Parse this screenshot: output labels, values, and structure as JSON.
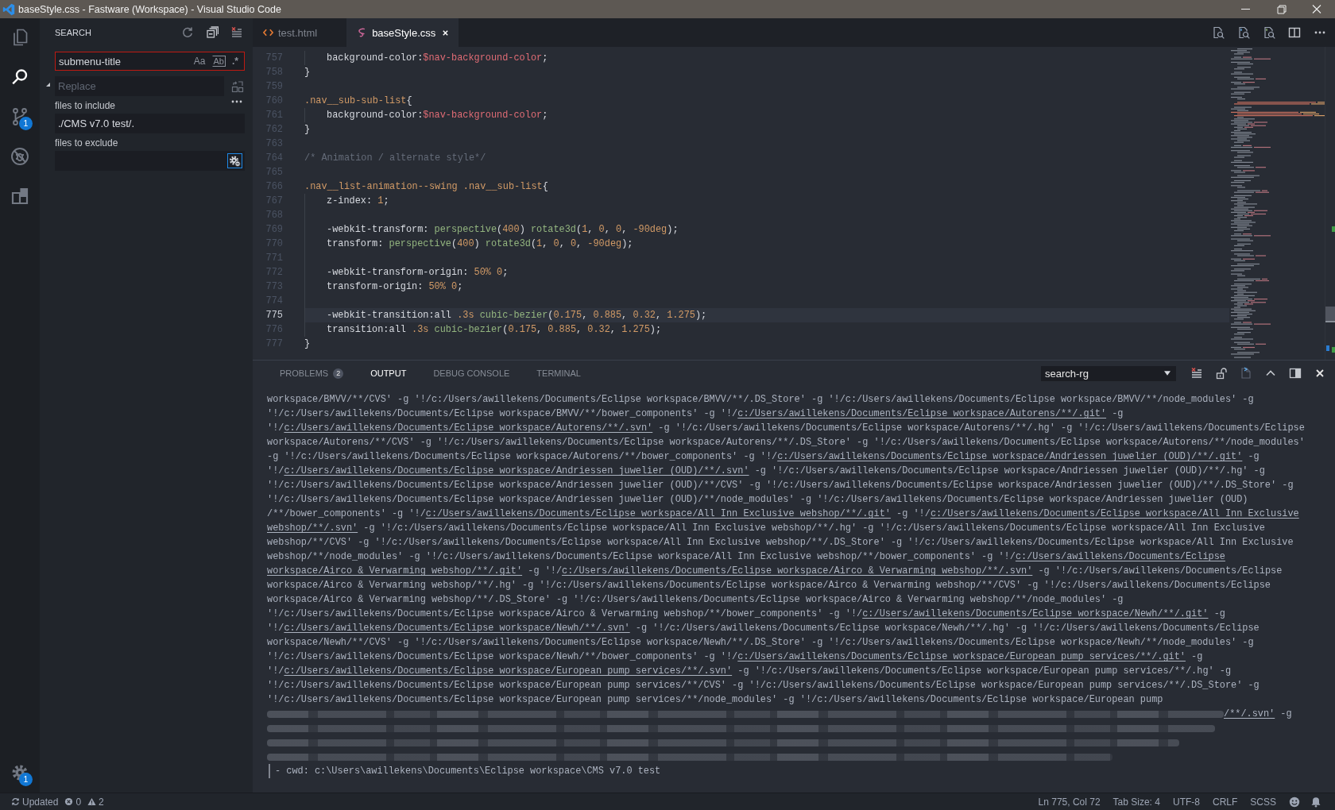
{
  "window": {
    "title": "baseStyle.css - Fastware (Workspace) - Visual Studio Code"
  },
  "activity_bar": {
    "items": [
      {
        "kind": "explorer",
        "selected": false
      },
      {
        "kind": "search",
        "selected": true
      },
      {
        "kind": "source_control",
        "selected": false,
        "badge": "1"
      },
      {
        "kind": "debug",
        "selected": false
      },
      {
        "kind": "extensions",
        "selected": false
      }
    ],
    "manage": {
      "badge": "1"
    }
  },
  "sidebar": {
    "title": "SEARCH",
    "search": {
      "value": "submenu-title",
      "toggles": [
        {
          "kind": "case",
          "label": "Aa",
          "on": false
        },
        {
          "kind": "word",
          "label": "Ab",
          "on": false
        },
        {
          "kind": "regex",
          "label": ".*",
          "on": false
        }
      ]
    },
    "replace": {
      "expanded": true,
      "placeholder": "Replace"
    },
    "include": {
      "label": "files to include",
      "value": "./CMS v7.0 test/."
    },
    "exclude": {
      "label": "files to exclude",
      "use_settings": true
    }
  },
  "editor": {
    "tabs": [
      {
        "kind": "html",
        "label": "test.html",
        "selected": false
      },
      {
        "kind": "sass",
        "label": "baseStyle.css",
        "selected": true
      }
    ],
    "lines": [
      {
        "number": "757",
        "indented": true,
        "current": false,
        "tokens": [
          {
            "kind": "property",
            "text": "background-color:"
          },
          {
            "kind": "variable",
            "text": "$nav-background-color"
          },
          {
            "kind": "punct",
            "text": ";"
          }
        ]
      },
      {
        "number": "758",
        "indented": false,
        "current": false,
        "tokens": [
          {
            "kind": "punct",
            "text": "}"
          }
        ]
      },
      {
        "number": "759",
        "indented": false,
        "current": false
      },
      {
        "number": "760",
        "indented": false,
        "current": false,
        "tokens": [
          {
            "kind": "selector",
            "text": ".nav__sub-sub-list"
          },
          {
            "kind": "punct",
            "text": "{"
          }
        ]
      },
      {
        "number": "761",
        "indented": true,
        "current": false,
        "tokens": [
          {
            "kind": "property",
            "text": "background-color:"
          },
          {
            "kind": "variable",
            "text": "$nav-background-color"
          },
          {
            "kind": "punct",
            "text": ";"
          }
        ]
      },
      {
        "number": "762",
        "indented": false,
        "current": false,
        "tokens": [
          {
            "kind": "punct",
            "text": "}"
          }
        ]
      },
      {
        "number": "763",
        "indented": false,
        "current": false
      },
      {
        "number": "764",
        "indented": false,
        "current": false,
        "tokens": [
          {
            "kind": "comment",
            "text": "/* Animation / alternate style*/"
          }
        ]
      },
      {
        "number": "765",
        "indented": false,
        "current": false
      },
      {
        "number": "766",
        "indented": false,
        "current": false,
        "tokens": [
          {
            "kind": "selector",
            "text": ".nav__list-animation--swing .nav__sub-list"
          },
          {
            "kind": "punct",
            "text": "{"
          }
        ]
      },
      {
        "number": "767",
        "indented": true,
        "current": false,
        "tokens": [
          {
            "kind": "property",
            "text": "z-index: "
          },
          {
            "kind": "number",
            "text": "1"
          },
          {
            "kind": "punct",
            "text": ";"
          }
        ]
      },
      {
        "number": "768",
        "indented": true,
        "current": false
      },
      {
        "number": "769",
        "indented": true,
        "current": false,
        "tokens": [
          {
            "kind": "property",
            "text": "-webkit-transform: "
          },
          {
            "kind": "function",
            "text": "perspective"
          },
          {
            "kind": "punct",
            "text": "("
          },
          {
            "kind": "number",
            "text": "400"
          },
          {
            "kind": "punct",
            "text": ") "
          },
          {
            "kind": "function",
            "text": "rotate3d"
          },
          {
            "kind": "punct",
            "text": "("
          },
          {
            "kind": "number",
            "text": "1"
          },
          {
            "kind": "punct",
            "text": ", "
          },
          {
            "kind": "number",
            "text": "0"
          },
          {
            "kind": "punct",
            "text": ", "
          },
          {
            "kind": "number",
            "text": "0"
          },
          {
            "kind": "punct",
            "text": ", "
          },
          {
            "kind": "number",
            "text": "-90deg"
          },
          {
            "kind": "punct",
            "text": ");"
          }
        ]
      },
      {
        "number": "770",
        "indented": true,
        "current": false,
        "tokens": [
          {
            "kind": "property",
            "text": "transform: "
          },
          {
            "kind": "function",
            "text": "perspective"
          },
          {
            "kind": "punct",
            "text": "("
          },
          {
            "kind": "number",
            "text": "400"
          },
          {
            "kind": "punct",
            "text": ") "
          },
          {
            "kind": "function",
            "text": "rotate3d"
          },
          {
            "kind": "punct",
            "text": "("
          },
          {
            "kind": "number",
            "text": "1"
          },
          {
            "kind": "punct",
            "text": ", "
          },
          {
            "kind": "number",
            "text": "0"
          },
          {
            "kind": "punct",
            "text": ", "
          },
          {
            "kind": "number",
            "text": "0"
          },
          {
            "kind": "punct",
            "text": ", "
          },
          {
            "kind": "number",
            "text": "-90deg"
          },
          {
            "kind": "punct",
            "text": ");"
          }
        ]
      },
      {
        "number": "771",
        "indented": true,
        "current": false
      },
      {
        "number": "772",
        "indented": true,
        "current": false,
        "tokens": [
          {
            "kind": "property",
            "text": "-webkit-transform-origin: "
          },
          {
            "kind": "number",
            "text": "50% 0"
          },
          {
            "kind": "punct",
            "text": ";"
          }
        ]
      },
      {
        "number": "773",
        "indented": true,
        "current": false,
        "tokens": [
          {
            "kind": "property",
            "text": "transform-origin: "
          },
          {
            "kind": "number",
            "text": "50% 0"
          },
          {
            "kind": "punct",
            "text": ";"
          }
        ]
      },
      {
        "number": "774",
        "indented": true,
        "current": false
      },
      {
        "number": "775",
        "indented": true,
        "current": true,
        "tokens": [
          {
            "kind": "property",
            "text": "-webkit-transition:all "
          },
          {
            "kind": "number",
            "text": ".3s "
          },
          {
            "kind": "function",
            "text": "cubic-bezier"
          },
          {
            "kind": "punct",
            "text": "("
          },
          {
            "kind": "number",
            "text": "0.175"
          },
          {
            "kind": "punct",
            "text": ", "
          },
          {
            "kind": "number",
            "text": "0.885"
          },
          {
            "kind": "punct",
            "text": ", "
          },
          {
            "kind": "number",
            "text": "0.32"
          },
          {
            "kind": "punct",
            "text": ", "
          },
          {
            "kind": "number",
            "text": "1.275"
          },
          {
            "kind": "punct",
            "text": ");"
          }
        ]
      },
      {
        "number": "776",
        "indented": true,
        "current": false,
        "tokens": [
          {
            "kind": "property",
            "text": "transition:all "
          },
          {
            "kind": "number",
            "text": ".3s "
          },
          {
            "kind": "function",
            "text": "cubic-bezier"
          },
          {
            "kind": "punct",
            "text": "("
          },
          {
            "kind": "number",
            "text": "0.175"
          },
          {
            "kind": "punct",
            "text": ", "
          },
          {
            "kind": "number",
            "text": "0.885"
          },
          {
            "kind": "punct",
            "text": ", "
          },
          {
            "kind": "number",
            "text": "0.32"
          },
          {
            "kind": "punct",
            "text": ", "
          },
          {
            "kind": "number",
            "text": "1.275"
          },
          {
            "kind": "punct",
            "text": ");"
          }
        ]
      },
      {
        "number": "777",
        "indented": false,
        "current": false,
        "tokens": [
          {
            "kind": "punct",
            "text": "}"
          }
        ]
      }
    ]
  },
  "panel": {
    "tabs": [
      {
        "label": "PROBLEMS",
        "badge": "2",
        "selected": false
      },
      {
        "label": "OUTPUT",
        "selected": true
      },
      {
        "label": "DEBUG CONSOLE",
        "selected": false
      },
      {
        "label": "TERMINAL",
        "selected": false
      }
    ],
    "channel": "search-rg",
    "lines": [
      {
        "kind": "text",
        "cursor": false,
        "segments": [
          {
            "text": "workspace/BMVV/**/CVS' -g '!/c:/Users/awillekens/Documents/Eclipse workspace/BMVV/**/.DS_Store' -g '!/c:/Users/awillekens/Documents/Eclipse workspace/BMVV/**/node_modules' -g",
            "link": false
          }
        ]
      },
      {
        "kind": "text",
        "cursor": false,
        "segments": [
          {
            "text": "'!/c:/Users/awillekens/Documents/Eclipse workspace/BMVV/**/bower_components' -g '!/",
            "link": false
          },
          {
            "text": "c:/Users/awillekens/Documents/Eclipse workspace/Autorens/**/.git'",
            "link": true
          },
          {
            "text": " -g",
            "link": false
          }
        ]
      },
      {
        "kind": "text",
        "cursor": false,
        "segments": [
          {
            "text": "'!/",
            "link": false
          },
          {
            "text": "c:/Users/awillekens/Documents/Eclipse workspace/Autorens/**/.svn'",
            "link": true
          },
          {
            "text": " -g '!/c:/Users/awillekens/Documents/Eclipse workspace/Autorens/**/.hg' -g '!/c:/Users/awillekens/Documents/Eclipse",
            "link": false
          }
        ]
      },
      {
        "kind": "text",
        "cursor": false,
        "segments": [
          {
            "text": "workspace/Autorens/**/CVS' -g '!/c:/Users/awillekens/Documents/Eclipse workspace/Autorens/**/.DS_Store' -g '!/c:/Users/awillekens/Documents/Eclipse workspace/Autorens/**/node_modules'",
            "link": false
          }
        ]
      },
      {
        "kind": "text",
        "cursor": false,
        "segments": [
          {
            "text": "-g '!/c:/Users/awillekens/Documents/Eclipse workspace/Autorens/**/bower_components' -g '!/",
            "link": false
          },
          {
            "text": "c:/Users/awillekens/Documents/Eclipse workspace/Andriessen juwelier (OUD)/**/.git'",
            "link": true
          },
          {
            "text": " -g",
            "link": false
          }
        ]
      },
      {
        "kind": "text",
        "cursor": false,
        "segments": [
          {
            "text": "'!/",
            "link": false
          },
          {
            "text": "c:/Users/awillekens/Documents/Eclipse workspace/Andriessen juwelier (OUD)/**/.svn'",
            "link": true
          },
          {
            "text": " -g '!/c:/Users/awillekens/Documents/Eclipse workspace/Andriessen juwelier (OUD)/**/.hg' -g",
            "link": false
          }
        ]
      },
      {
        "kind": "text",
        "cursor": false,
        "segments": [
          {
            "text": "'!/c:/Users/awillekens/Documents/Eclipse workspace/Andriessen juwelier (OUD)/**/CVS' -g '!/c:/Users/awillekens/Documents/Eclipse workspace/Andriessen juwelier (OUD)/**/.DS_Store' -g",
            "link": false
          }
        ]
      },
      {
        "kind": "text",
        "cursor": false,
        "segments": [
          {
            "text": "'!/c:/Users/awillekens/Documents/Eclipse workspace/Andriessen juwelier (OUD)/**/node_modules' -g '!/c:/Users/awillekens/Documents/Eclipse workspace/Andriessen juwelier (OUD)",
            "link": false
          }
        ]
      },
      {
        "kind": "text",
        "cursor": false,
        "segments": [
          {
            "text": "/**/bower_components' -g '!/",
            "link": false
          },
          {
            "text": "c:/Users/awillekens/Documents/Eclipse workspace/All Inn Exclusive webshop/**/.git'",
            "link": true
          },
          {
            "text": " -g '!/",
            "link": false
          },
          {
            "text": "c:/Users/awillekens/Documents/Eclipse workspace/All Inn Exclusive",
            "link": true
          }
        ]
      },
      {
        "kind": "text",
        "cursor": false,
        "segments": [
          {
            "text": "webshop/**/.svn'",
            "link": true
          },
          {
            "text": " -g '!/c:/Users/awillekens/Documents/Eclipse workspace/All Inn Exclusive webshop/**/.hg' -g '!/c:/Users/awillekens/Documents/Eclipse workspace/All Inn Exclusive",
            "link": false
          }
        ]
      },
      {
        "kind": "text",
        "cursor": false,
        "segments": [
          {
            "text": "webshop/**/CVS' -g '!/c:/Users/awillekens/Documents/Eclipse workspace/All Inn Exclusive webshop/**/.DS_Store' -g '!/c:/Users/awillekens/Documents/Eclipse workspace/All Inn Exclusive",
            "link": false
          }
        ]
      },
      {
        "kind": "text",
        "cursor": false,
        "segments": [
          {
            "text": "webshop/**/node_modules' -g '!/c:/Users/awillekens/Documents/Eclipse workspace/All Inn Exclusive webshop/**/bower_components' -g '!/",
            "link": false
          },
          {
            "text": "c:/Users/awillekens/Documents/Eclipse",
            "link": true
          }
        ]
      },
      {
        "kind": "text",
        "cursor": false,
        "segments": [
          {
            "text": "workspace/Airco & Verwarming webshop/**/.git'",
            "link": true
          },
          {
            "text": " -g '!/",
            "link": false
          },
          {
            "text": "c:/Users/awillekens/Documents/Eclipse workspace/Airco & Verwarming webshop/**/.svn'",
            "link": true
          },
          {
            "text": " -g '!/c:/Users/awillekens/Documents/Eclipse",
            "link": false
          }
        ]
      },
      {
        "kind": "text",
        "cursor": false,
        "segments": [
          {
            "text": "workspace/Airco & Verwarming webshop/**/.hg' -g '!/c:/Users/awillekens/Documents/Eclipse workspace/Airco & Verwarming webshop/**/CVS' -g '!/c:/Users/awillekens/Documents/Eclipse",
            "link": false
          }
        ]
      },
      {
        "kind": "text",
        "cursor": false,
        "segments": [
          {
            "text": "workspace/Airco & Verwarming webshop/**/.DS_Store' -g '!/c:/Users/awillekens/Documents/Eclipse workspace/Airco & Verwarming webshop/**/node_modules' -g",
            "link": false
          }
        ]
      },
      {
        "kind": "text",
        "cursor": false,
        "segments": [
          {
            "text": "'!/c:/Users/awillekens/Documents/Eclipse workspace/Airco & Verwarming webshop/**/bower_components' -g '!/",
            "link": false
          },
          {
            "text": "c:/Users/awillekens/Documents/Eclipse workspace/Newh/**/.git'",
            "link": true
          },
          {
            "text": " -g",
            "link": false
          }
        ]
      },
      {
        "kind": "text",
        "cursor": false,
        "segments": [
          {
            "text": "'!/",
            "link": false
          },
          {
            "text": "c:/Users/awillekens/Documents/Eclipse workspace/Newh/**/.svn'",
            "link": true
          },
          {
            "text": " -g '!/c:/Users/awillekens/Documents/Eclipse workspace/Newh/**/.hg' -g '!/c:/Users/awillekens/Documents/Eclipse",
            "link": false
          }
        ]
      },
      {
        "kind": "text",
        "cursor": false,
        "segments": [
          {
            "text": "workspace/Newh/**/CVS' -g '!/c:/Users/awillekens/Documents/Eclipse workspace/Newh/**/.DS_Store' -g '!/c:/Users/awillekens/Documents/Eclipse workspace/Newh/**/node_modules' -g",
            "link": false
          }
        ]
      },
      {
        "kind": "text",
        "cursor": false,
        "segments": [
          {
            "text": "'!/c:/Users/awillekens/Documents/Eclipse workspace/Newh/**/bower_components' -g '!/",
            "link": false
          },
          {
            "text": "c:/Users/awillekens/Documents/Eclipse workspace/European pump services/**/.git'",
            "link": true
          },
          {
            "text": " -g",
            "link": false
          }
        ]
      },
      {
        "kind": "text",
        "cursor": false,
        "segments": [
          {
            "text": "'!/",
            "link": false
          },
          {
            "text": "c:/Users/awillekens/Documents/Eclipse workspace/European pump services/**/.svn'",
            "link": true
          },
          {
            "text": " -g '!/c:/Users/awillekens/Documents/Eclipse workspace/European pump services/**/.hg' -g",
            "link": false
          }
        ]
      },
      {
        "kind": "text",
        "cursor": false,
        "segments": [
          {
            "text": "'!/c:/Users/awillekens/Documents/Eclipse workspace/European pump services/**/CVS' -g '!/c:/Users/awillekens/Documents/Eclipse workspace/European pump services/**/.DS_Store' -g",
            "link": false
          }
        ]
      },
      {
        "kind": "text",
        "cursor": false,
        "segments": [
          {
            "text": "'!/c:/Users/awillekens/Documents/Eclipse workspace/European pump services/**/node_modules' -g '!/c:/Users/awillekens/Documents/Eclipse workspace/European pump",
            "link": false
          }
        ]
      },
      {
        "kind": "blurred",
        "cursor": false,
        "segments": [
          {
            "text": "/**/.svn'",
            "link": true
          },
          {
            "text": " -g",
            "link": false
          }
        ]
      },
      {
        "kind": "blurred",
        "cursor": false
      },
      {
        "kind": "blurred",
        "cursor": false
      },
      {
        "kind": "blurred",
        "cursor": false
      },
      {
        "kind": "text",
        "cursor": true,
        "segments": [
          {
            "text": "- cwd: c:\\Users\\awillekens\\Documents\\Eclipse workspace\\CMS v7.0 test",
            "link": false
          }
        ]
      }
    ]
  },
  "status_bar": {
    "left": [
      {
        "kind": "sync",
        "label": "Updated"
      },
      {
        "kind": "errors",
        "label": "0"
      },
      {
        "kind": "warnings",
        "label": "2"
      }
    ],
    "right": [
      "Ln 775, Col 72",
      "Tab Size: 4",
      "UTF-8",
      "CRLF",
      "SCSS"
    ]
  }
}
